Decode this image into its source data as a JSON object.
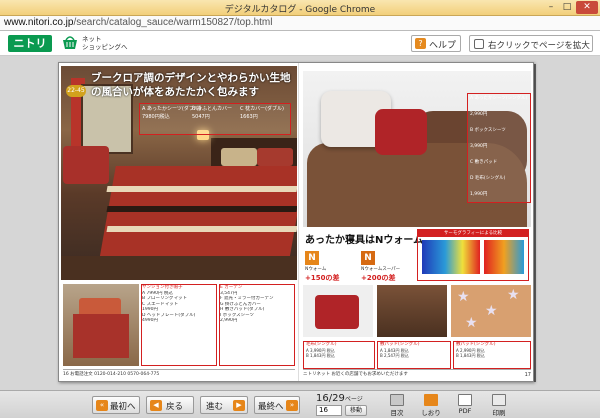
{
  "window": {
    "title": "デジタルカタログ - Google Chrome",
    "min": "–",
    "max": "□",
    "close": "✕"
  },
  "address": {
    "host": "www.nitori.co.jp",
    "path": "/search/catalog_sauce/warm150827/top.html"
  },
  "header": {
    "logo": "ニトリ",
    "net_line1": "ネット",
    "net_line2": "ショッピングへ",
    "help": "ヘルプ",
    "zoom": "右クリックでページを拡大"
  },
  "catalog": {
    "left": {
      "tag": "22-45",
      "headline": "ブークロア調のデザインとやわらかい生地の風合いが体をあたたかく包みます",
      "price_rows": [
        "A あったかシーツ(ダブル)",
        "B 掛ふとんカバー",
        "C 枕カバー(ダブル)",
        "7980円税込",
        "5047円",
        "1663円"
      ],
      "specs_col1": [
        "ヤンション付き帽子",
        "A 7990円 税込",
        "B フローリングマット",
        "C スエードマット",
        "1990円",
        "D へッドプレート(ダブル)",
        "4990円"
      ],
      "specs_col2": [
        "E カーテン",
        "3,547円",
        "F 遮光・ミラー付カーテン",
        "G 掛けふとんカバー",
        "H 敷きパッド(ダブル)",
        "I ボックスシーツ",
        "2,990円"
      ],
      "footer": "16  お電話注文 0120-014-210    0570-064-775",
      "page_no": "16"
    },
    "right": {
      "box_rows": [
        "A あったかシーツ(シングル)",
        "B ボックスシーツ",
        "C 敷きパッド",
        "D 毛布(シングル)",
        "2,990円",
        "3,990円",
        "1,990円"
      ],
      "warm_title": "あったか寝具はNウォーム",
      "n_label1": "N",
      "n_label2": "N",
      "n_text1": "Nウォーム",
      "n_price1": "+150の差",
      "n_text2": "Nウォームスーパー",
      "n_price2": "+200の差",
      "thermo_head": "サーモグラフィーによる比較",
      "spec1_head": "毛布(シングル)",
      "spec1_lines": [
        "A 3,990円 税込",
        "B 1,843円 税込"
      ],
      "spec2_head": "敷パッド(シングル)",
      "spec2_lines": [
        "A 1,843円 税込",
        "B 2,547円 税込"
      ],
      "spec3_head": "敷パッド(シングル)",
      "spec3_lines": [
        "A 2,990円 税込",
        "B 1,843円 税込"
      ],
      "footer": "ニトリネット お近くの店舗でもお求めいただけます",
      "page_no": "17"
    }
  },
  "nav": {
    "first": "最初へ",
    "prev": "戻る",
    "next": "進む",
    "last": "最終へ",
    "page_current": "16/29",
    "page_unit": "ページ",
    "page_input": "16",
    "go": "移動",
    "toc": "目次",
    "bookmark": "しおり",
    "pdf": "PDF",
    "print": "印刷"
  }
}
